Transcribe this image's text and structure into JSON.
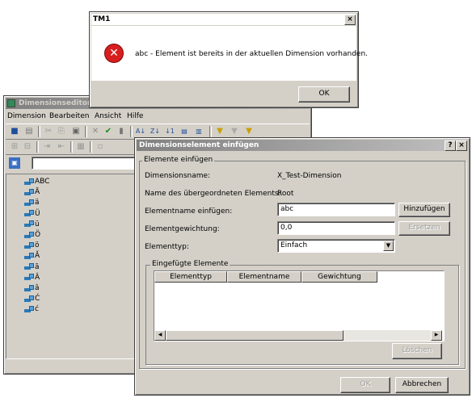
{
  "msgbox": {
    "title": "TM1",
    "message": "abc - Element ist bereits in der aktuellen Dimension vorhanden.",
    "ok_label": "OK",
    "close_glyph": "×"
  },
  "dimeditor": {
    "title": "Dimensionseditor:",
    "menu": [
      "Dimension",
      "Bearbeiten",
      "Ansicht",
      "Hilfe"
    ],
    "tree_items": [
      "ABC",
      "Ä",
      "ä",
      "Ü",
      "ü",
      "Ö",
      "ö",
      "Ă",
      "ă",
      "Â",
      "â",
      "Ć",
      "ć"
    ]
  },
  "insertdlg": {
    "title": "Dimensionselement einfügen",
    "help_glyph": "?",
    "close_glyph": "×",
    "group1_label": "Elemente einfügen",
    "dimname_label": "Dimensionsname:",
    "dimname_value": "X_Test-Dimension",
    "parent_label": "Name des übergeordneten Elements:",
    "parent_value": "Root",
    "elemname_label": "Elementname einfügen:",
    "elemname_value": "abc",
    "weight_label": "Elementgewichtung:",
    "weight_value": "0,0",
    "type_label": "Elementtyp:",
    "type_value": "Einfach",
    "add_label": "Hinzufügen",
    "replace_label": "Ersetzen",
    "group2_label": "Eingefügte Elemente",
    "columns": [
      "Elementtyp",
      "Elementname",
      "Gewichtung"
    ],
    "delete_label": "Löschen",
    "ok_label": "OK",
    "cancel_label": "Abbrechen"
  },
  "colors": {
    "face": "#d4d0c8",
    "error_red": "#d81e1e",
    "tree_icon_blue": "#2a7ab8"
  }
}
